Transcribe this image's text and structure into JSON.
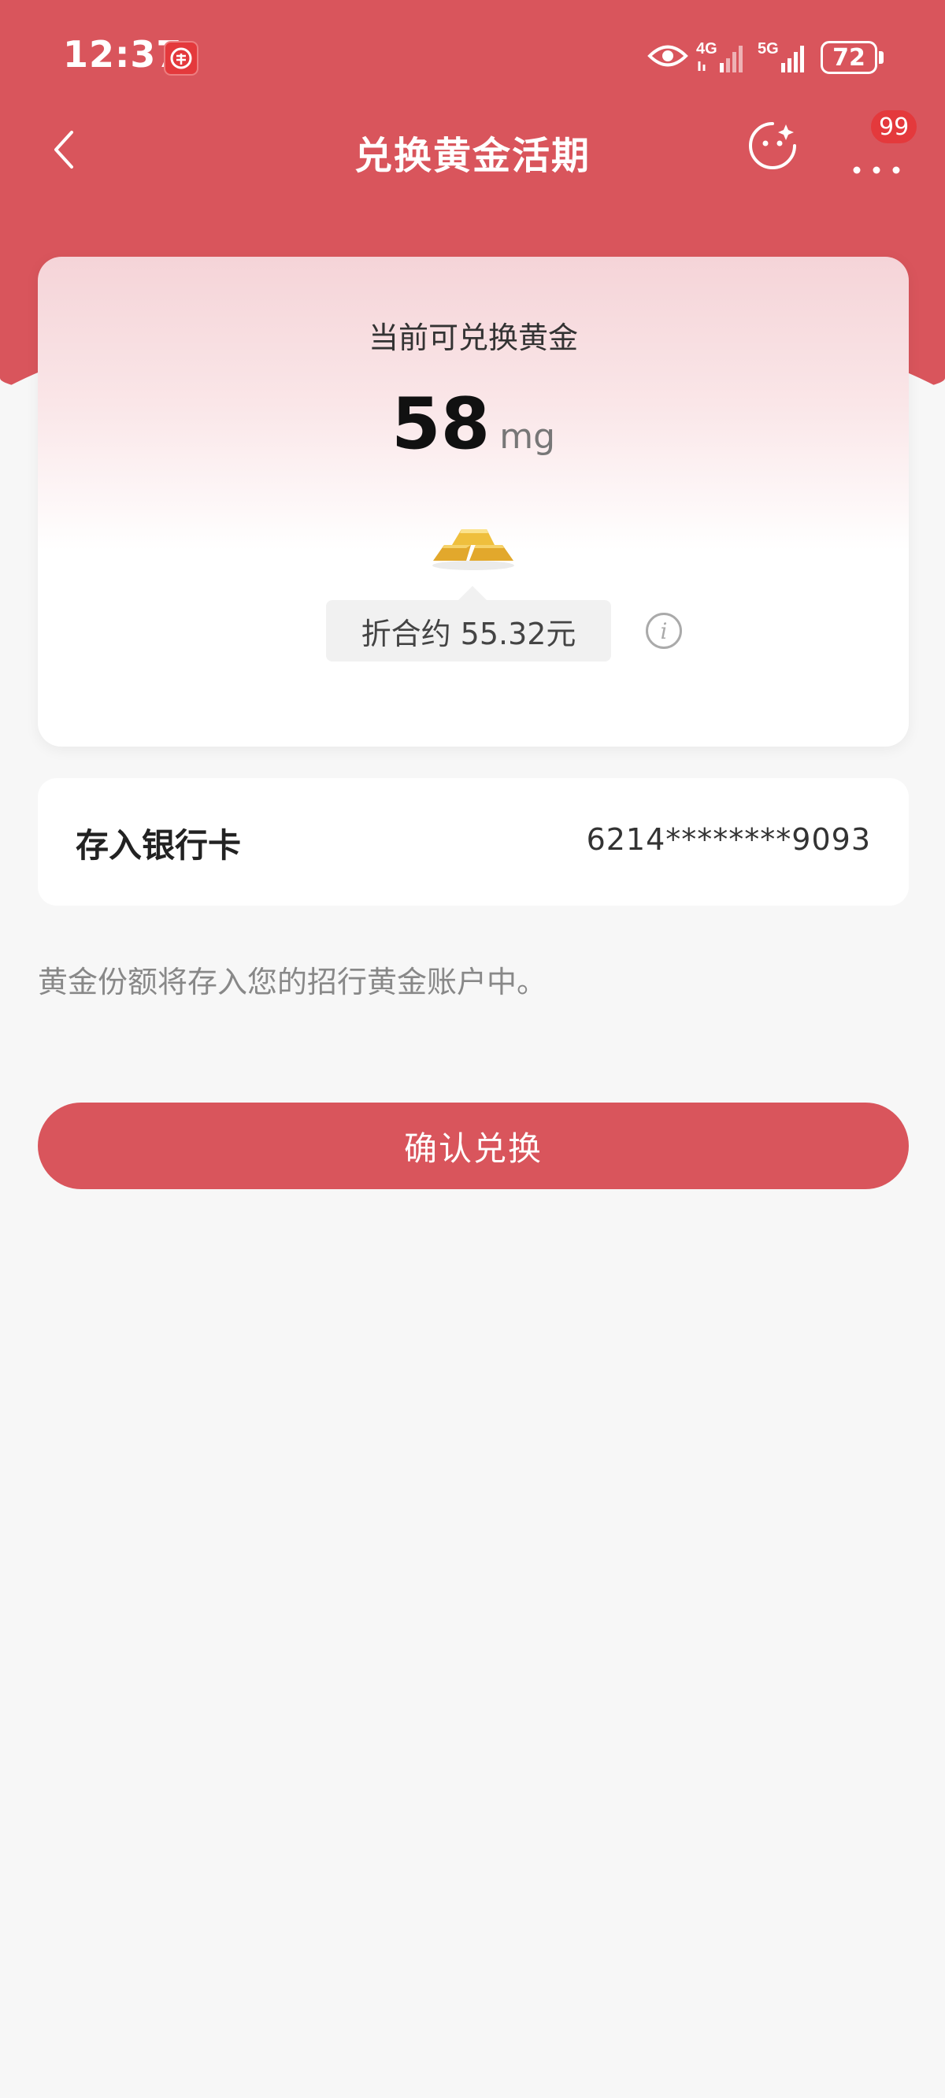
{
  "status_bar": {
    "time": "12:37",
    "battery": "72",
    "network_1": "4G",
    "network_2": "5G"
  },
  "nav": {
    "title": "兑换黄金活期",
    "badge_count": "99"
  },
  "gold_card": {
    "label": "当前可兑换黄金",
    "amount": "58",
    "unit": "mg",
    "converted": "折合约 55.32元"
  },
  "deposit": {
    "label": "存入银行卡",
    "card_number": "6214********9093"
  },
  "note": "黄金份额将存入您的招行黄金账户中。",
  "confirm_button": "确认兑换",
  "colors": {
    "accent": "#d9555c",
    "background": "#f7f7f7"
  }
}
